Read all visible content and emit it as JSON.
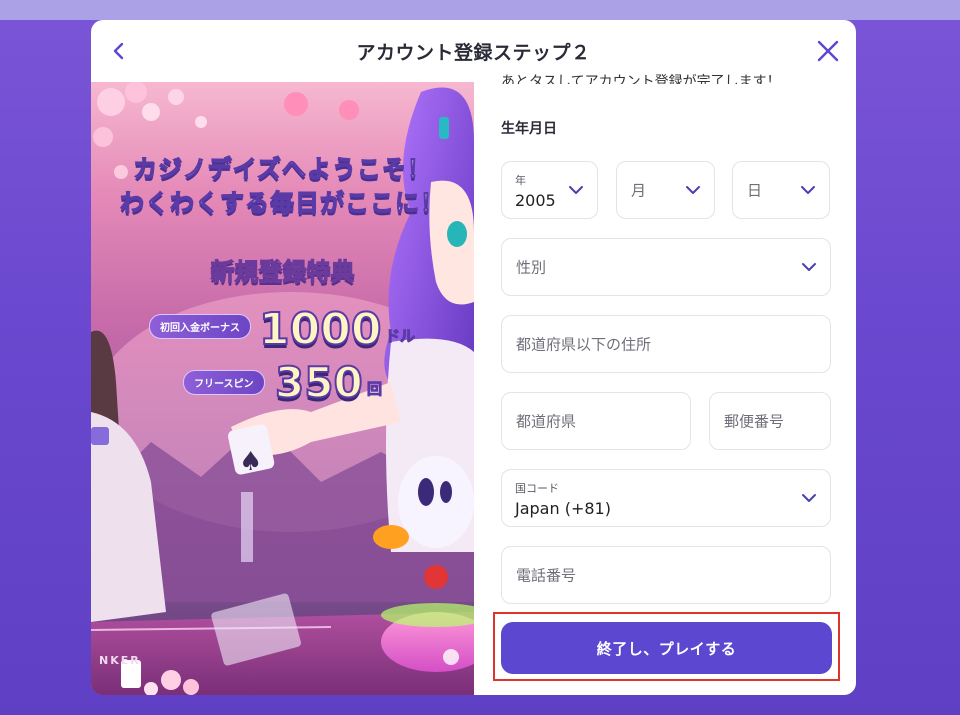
{
  "header": {
    "title": "アカウント登録ステップ２",
    "back_icon": "chevron-left-icon",
    "close_icon": "close-icon"
  },
  "promo": {
    "welcome_line1": "カジノデイズへようこそ！",
    "welcome_line2": "わくわくする毎日がここに！",
    "special_title": "新規登録特典",
    "bonus1_label": "初回入金ボーナス",
    "bonus1_amount": "1000",
    "bonus1_unit": "ドル",
    "bonus2_label": "フリースピン",
    "bonus2_amount": "350",
    "bonus2_unit": "回",
    "table_text": "NKER"
  },
  "form": {
    "clipped_text": "あとタスしてアカウント登録が完了します！",
    "dob_label": "生年月日",
    "year_label": "年",
    "year_value": "2005",
    "month_placeholder": "月",
    "day_placeholder": "日",
    "gender_placeholder": "性別",
    "address_placeholder": "都道府県以下の住所",
    "prefecture_placeholder": "都道府県",
    "postal_placeholder": "郵便番号",
    "country_code_label": "国コード",
    "country_code_value": "Japan (+81)",
    "phone_placeholder": "電話番号",
    "submit_label": "終了し、プレイする"
  },
  "colors": {
    "background": "#6a48cf",
    "accent": "#5b47d0",
    "highlight_border": "#e0342a"
  }
}
